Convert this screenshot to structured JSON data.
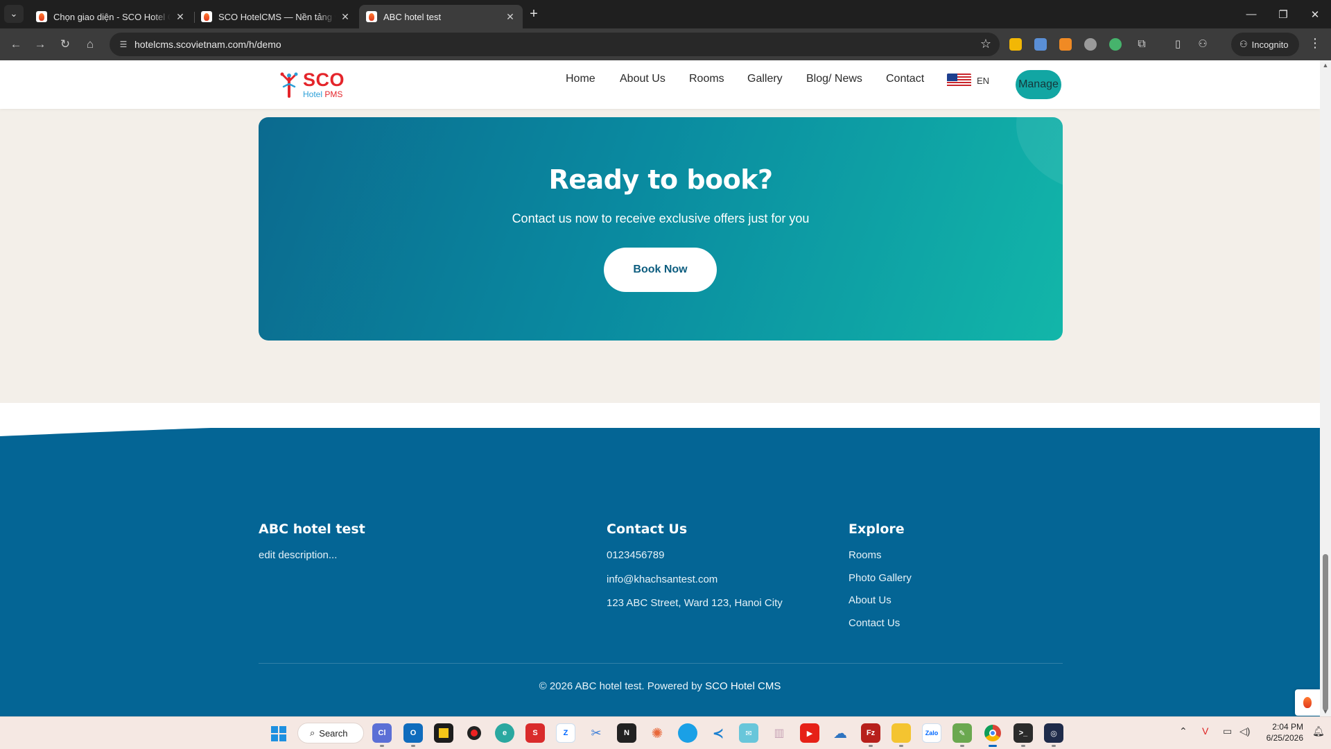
{
  "browser": {
    "tabs": [
      {
        "title": "Chọn giao diện - SCO Hotel CMS"
      },
      {
        "title": "SCO HotelCMS — Nền tảng web khách sạn"
      },
      {
        "title": "ABC hotel test"
      }
    ],
    "url": "hotelcms.scovietnam.com/h/demo",
    "incognito_label": "Incognito"
  },
  "site": {
    "logo": {
      "brand": "SCO",
      "sub_a": "Hotel",
      "sub_b": "PMS"
    },
    "nav": [
      "Home",
      "About Us",
      "Rooms",
      "Gallery",
      "Blog/ News",
      "Contact"
    ],
    "lang": "EN",
    "manage_label": "Manage"
  },
  "cta": {
    "title": "Ready to book?",
    "subtitle": "Contact us now to receive exclusive offers just for you",
    "button": "Book Now"
  },
  "footer": {
    "about": {
      "title": "ABC hotel test",
      "description": "edit description..."
    },
    "contact": {
      "title": "Contact Us",
      "phone": "0123456789",
      "email": "info@khachsantest.com",
      "address": "123 ABC Street, Ward 123, Hanoi City"
    },
    "explore": {
      "title": "Explore",
      "links": [
        "Rooms",
        "Photo Gallery",
        "About Us",
        "Contact Us"
      ]
    },
    "copyright_prefix": "© 2026 ABC hotel test. Powered by",
    "copyright_brand": "SCO Hotel CMS"
  },
  "taskbar": {
    "search_label": "Search",
    "time": "2:04 PM",
    "date": "6/25/2026"
  },
  "colors": {
    "cta_start": "#0b6a8f",
    "cta_end": "#12b6a9",
    "footer_bg": "#046595",
    "manage_bg": "#12a6a3",
    "brand_red": "#e4252b"
  }
}
